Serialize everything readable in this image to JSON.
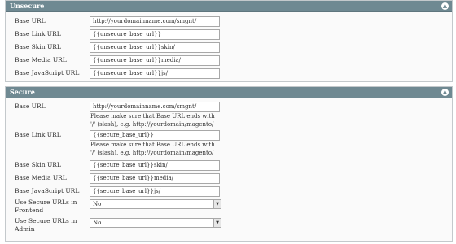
{
  "unsecure": {
    "title": "Unsecure",
    "fields": [
      {
        "label": "Base URL",
        "value": "http://yourdomainname.com/smgnt/"
      },
      {
        "label": "Base Link URL",
        "value": "{{unsecure_base_url}}"
      },
      {
        "label": "Base Skin URL",
        "value": "{{unsecure_base_url}}skin/"
      },
      {
        "label": "Base Media URL",
        "value": "{{unsecure_base_url}}media/"
      },
      {
        "label": "Base JavaScript URL",
        "value": "{{unsecure_base_url}}js/"
      }
    ]
  },
  "secure": {
    "title": "Secure",
    "fields": [
      {
        "label": "Base URL",
        "value": "http://yourdomainname.com/smgnt/",
        "note": [
          "Please make sure that Base URL ends with",
          "'/' (slash), e.g. http://yourdomain/magento/"
        ]
      },
      {
        "label": "Base Link URL",
        "value": "{{secure_base_url}}",
        "note": [
          "Please make sure that Base URL ends with",
          "'/' (slash), e.g. http://yourdomain/magento/"
        ]
      },
      {
        "label": "Base Skin URL",
        "value": "{{secure_base_url}}skin/"
      },
      {
        "label": "Base Media URL",
        "value": "{{secure_base_url}}media/"
      },
      {
        "label": "Base JavaScript URL",
        "value": "{{secure_base_url}}js/"
      }
    ],
    "selects": [
      {
        "label": [
          "Use Secure URLs in",
          "Frontend"
        ],
        "value": "No"
      },
      {
        "label": [
          "Use Secure URLs in",
          "Admin"
        ],
        "value": "No"
      }
    ]
  },
  "icons": {
    "collapse": "collapse-icon",
    "dropdown": "dropdown-arrow-icon"
  }
}
